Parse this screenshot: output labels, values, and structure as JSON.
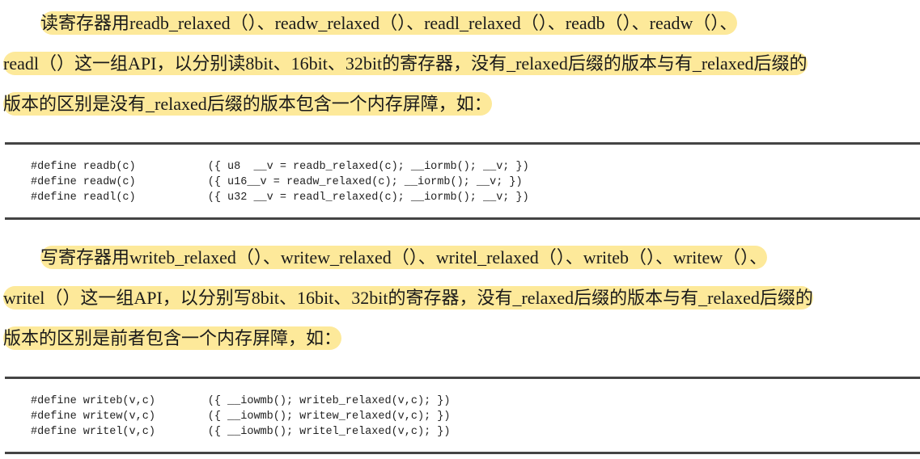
{
  "read_section": {
    "lines": [
      "读寄存器用readb_relaxed（）、readw_relaxed（）、readl_relaxed（）、readb（）、readw（）、",
      "readl（）这一组API，以分别读8bit、16bit、32bit的寄存器，没有_relaxed后缀的版本与有_relaxed后缀的",
      "版本的区别是没有_relaxed后缀的版本包含一个内存屏障，如："
    ],
    "code": [
      "#define readb(c)           ({ u8  __v = readb_relaxed(c); __iormb(); __v; })",
      "#define readw(c)           ({ u16__v = readw_relaxed(c); __iormb(); __v; })",
      "#define readl(c)           ({ u32 __v = readl_relaxed(c); __iormb(); __v; })"
    ]
  },
  "write_section": {
    "lines": [
      "写寄存器用writeb_relaxed（）、writew_relaxed（）、writel_relaxed（）、writeb（）、writew（）、",
      "writel（）这一组API，以分别写8bit、16bit、32bit的寄存器，没有_relaxed后缀的版本与有_relaxed后缀的",
      "版本的区别是前者包含一个内存屏障，如："
    ],
    "code": [
      "#define writeb(v,c)        ({ __iowmb(); writeb_relaxed(v,c); })",
      "#define writew(v,c)        ({ __iowmb(); writew_relaxed(v,c); })",
      "#define writel(v,c)        ({ __iowmb(); writel_relaxed(v,c); })"
    ]
  },
  "colors": {
    "highlight": "#fde99a",
    "rule": "#444444"
  }
}
